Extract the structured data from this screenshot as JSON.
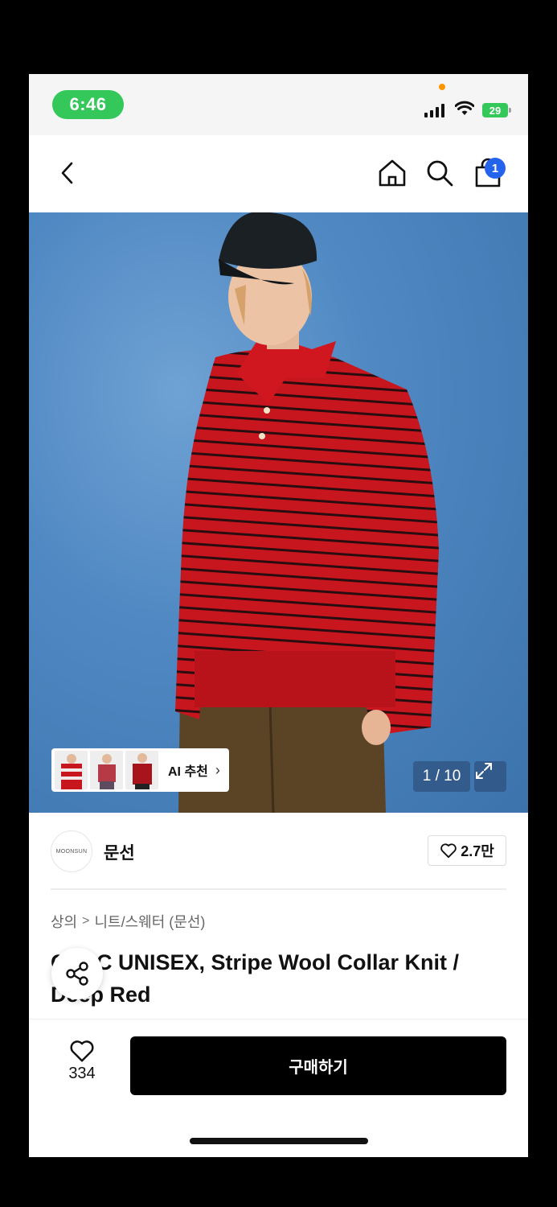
{
  "status_bar": {
    "time": "6:46",
    "battery": "29"
  },
  "header": {
    "cart_count": "1"
  },
  "hero": {
    "ai_recommend_label": "AI 추천",
    "image_counter": "1 / 10"
  },
  "brand": {
    "logo_text": "MOONSUN",
    "name": "문선",
    "likes": "2.7만"
  },
  "breadcrumb": {
    "category": "상의",
    "separator": ">",
    "subcategory": "니트/스웨터 (문선)"
  },
  "product": {
    "title": "C.M.C UNISEX, Stripe Wool Collar Knit / Deep Red"
  },
  "bottom": {
    "wish_count": "334",
    "buy_label": "구매하기"
  },
  "colors": {
    "accent_blue": "#2463eb",
    "status_green": "#34c759",
    "sweater_red": "#c8161e"
  }
}
